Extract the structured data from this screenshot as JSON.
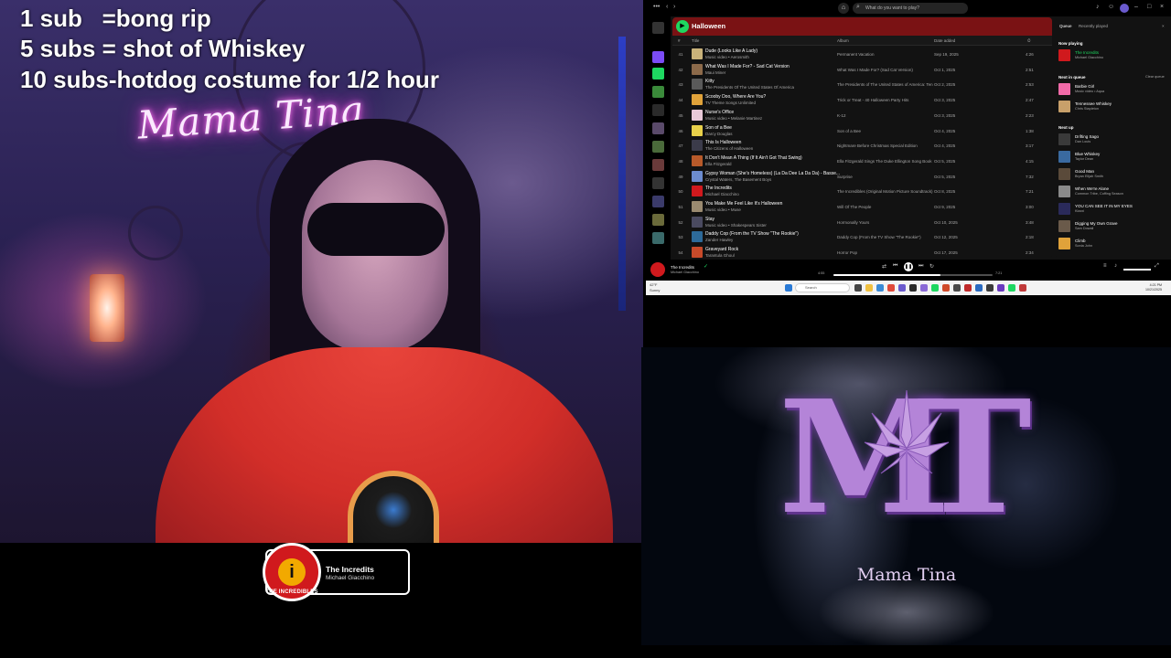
{
  "overlay": {
    "line1": "1 sub   =bong rip",
    "line2": "5 subs = shot of Whiskey",
    "line3": "10 subs-hotdog costume for 1/2 hour"
  },
  "neon_sign": "Mama Tina",
  "now_playing_card": {
    "logo_mark": "i",
    "logo_text": "THE INCREDIBLES",
    "title": "The Incredits",
    "artist": "Michael Giacchino"
  },
  "spotify": {
    "search_placeholder": "What do you want to play?",
    "playlist_title": "Halloween",
    "columns": {
      "num": "#",
      "title": "Title",
      "album": "Album",
      "date": "Date added",
      "duration": "⏱"
    },
    "tracks": [
      {
        "num": "41",
        "title": "Dude (Looks Like A Lady)",
        "artist": "Music video • Aerosmith",
        "album": "Permanent Vacation",
        "date": "Sep 19, 2025",
        "dur": "4:26",
        "art": "#c9b27a"
      },
      {
        "num": "42",
        "title": "What Was I Made For? - Sad Cat Version",
        "artist": "Maui Miner",
        "album": "What Was I Made For? (Sad Cat Version)",
        "date": "Oct 1, 2025",
        "dur": "2:51",
        "art": "#8c6a4a"
      },
      {
        "num": "43",
        "title": "Kitty",
        "artist": "The Presidents Of The United States Of America",
        "album": "The Presidents of The United States of America: Ten Y...",
        "date": "Oct 2, 2025",
        "dur": "2:53",
        "art": "#5a5a5a"
      },
      {
        "num": "44",
        "title": "Scooby Doo, Where Are You?",
        "artist": "TV Theme Songs Unlimited",
        "album": "Trick or Treat - 40 Halloween Party Hits",
        "date": "Oct 3, 2025",
        "dur": "2:47",
        "art": "#e0a23a"
      },
      {
        "num": "45",
        "title": "Nurse's Office",
        "artist": "Music video • Melanie Martinez",
        "album": "K-12",
        "date": "Oct 3, 2025",
        "dur": "2:23",
        "art": "#e9c9d8"
      },
      {
        "num": "46",
        "title": "Son of a Bee",
        "artist": "Darcy Douglas",
        "album": "Son of a Bee",
        "date": "Oct 4, 2025",
        "dur": "1:38",
        "art": "#e8d04a"
      },
      {
        "num": "47",
        "title": "This Is Halloween",
        "artist": "The Citizens of Halloween",
        "album": "Nightmare Before Christmas Special Edition",
        "date": "Oct 4, 2025",
        "dur": "3:17",
        "art": "#3b3b4a"
      },
      {
        "num": "48",
        "title": "It Don't Mean A Thing (If It Ain't Got That Swing)",
        "artist": "Ella Fitzgerald",
        "album": "Ella Fitzgerald Sings The Duke Ellington Song Book",
        "date": "Oct 5, 2025",
        "dur": "4:15",
        "art": "#b85a2a"
      },
      {
        "num": "49",
        "title": "Gypsy Woman (She's Homeless) (La Da Dee La Da Da) - Basse...",
        "artist": "Crystal Waters, The Basement Boys",
        "album": "Surprise",
        "date": "Oct 5, 2025",
        "dur": "7:32",
        "art": "#6c8ccf"
      },
      {
        "num": "50",
        "title": "The Incredits",
        "artist": "Michael Giacchino",
        "album": "The Incredibles (Original Motion Picture Soundtrack)",
        "date": "Oct 8, 2025",
        "dur": "7:21",
        "art": "#d0191d"
      },
      {
        "num": "51",
        "title": "You Make Me Feel Like It's Halloween",
        "artist": "Music video • Muse",
        "album": "Will Of The People",
        "date": "Oct 9, 2025",
        "dur": "3:00",
        "art": "#9a8a70"
      },
      {
        "num": "52",
        "title": "Stay",
        "artist": "Music video • Shakespears Sister",
        "album": "Hormonally Yours",
        "date": "Oct 10, 2025",
        "dur": "3:48",
        "art": "#4a4a60"
      },
      {
        "num": "53",
        "title": "Daddy Cop (From the TV Show \"The Rookie\")",
        "artist": "Zander Hawley",
        "album": "Daddy Cop (From the TV Show \"The Rookie\")",
        "date": "Oct 12, 2025",
        "dur": "2:18",
        "art": "#2d6a9a"
      },
      {
        "num": "54",
        "title": "Graveyard Rock",
        "artist": "Tarantula Ghoul",
        "album": "Horror Pop",
        "date": "Oct 17, 2025",
        "dur": "2:34",
        "art": "#c84a2a"
      }
    ],
    "queue": {
      "tab_queue": "Queue",
      "tab_recent": "Recently played",
      "now_playing_label": "Now playing",
      "now_playing": {
        "name": "The Incredits",
        "artist": "Michael Giacchino",
        "art": "#d0191d"
      },
      "next_in_queue_label": "Next in queue",
      "clear_label": "Clear queue",
      "queue_items": [
        {
          "name": "Barbie Girl",
          "artist": "Music video • Aqua",
          "art": "#f06aa8"
        },
        {
          "name": "Tennessee Whiskey",
          "artist": "Chris Stapleton",
          "art": "#c8a06a"
        }
      ],
      "next_up_label": "Next up",
      "next_up": [
        {
          "name": "Drifting Sago",
          "artist": "Dan Louis",
          "art": "#3a3a3a"
        },
        {
          "name": "Blue Whiskey",
          "artist": "Taylor Dean",
          "art": "#3a6aa0"
        },
        {
          "name": "Good Man",
          "artist": "Bryan Elijah Smith",
          "art": "#5a4a3a"
        },
        {
          "name": "When We're Alone",
          "artist": "Common Tribe, Coffing Season",
          "art": "#8a8a8a"
        },
        {
          "name": "YOU CAN SEE IT IN MY EYES",
          "artist": "Klaxxi",
          "art": "#2a2a5a"
        },
        {
          "name": "Digging My Own Grave",
          "artist": "Sam Dowall",
          "art": "#6a5a4a"
        },
        {
          "name": "Climb",
          "artist": "Sonia John",
          "art": "#e0a23a"
        }
      ]
    },
    "player": {
      "title": "The Incredits",
      "artist": "Michael Giacchino",
      "elapsed": "4:55",
      "total": "7:21",
      "progress": 0.67
    }
  },
  "taskbar": {
    "weather_temp": "42°F",
    "weather_desc": "Sunny",
    "search": "Search",
    "clock_time": "4:21 PM",
    "clock_date": "10/21/2025"
  },
  "logo": {
    "letters": "MT",
    "name": "Mama Tina"
  }
}
